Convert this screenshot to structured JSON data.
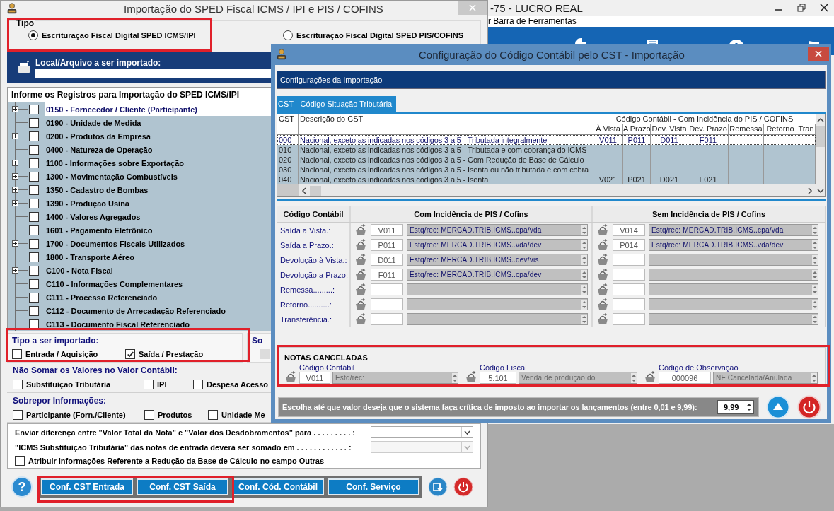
{
  "background_window": {
    "title": "-75 - LUCRO REAL",
    "menu_text": "r Barra de Ferramentas"
  },
  "import_window": {
    "title": "Importação do SPED Fiscal ICMS / IPI e PIS / COFINS",
    "tipo": {
      "label": "Tipo",
      "options": [
        {
          "label": "Escrituração Fiscal Digital SPED ICMS/IPI",
          "selected": true
        },
        {
          "label": "Escrituração Fiscal Digital SPED PIS/COFINS",
          "selected": false
        }
      ]
    },
    "file": {
      "label": "Local/Arquivo a ser importado:"
    },
    "registros": {
      "title": "Informe os Registros para Importação do SPED ICMS/IPI",
      "items": [
        {
          "label": "0150 - Fornecedor / Cliente (Participante)",
          "expandable": true,
          "checked": false,
          "selected": true
        },
        {
          "label": "0190 - Unidade de Medida",
          "expandable": false,
          "checked": false,
          "selected": false
        },
        {
          "label": "0200 - Produtos da Empresa",
          "expandable": true,
          "checked": false,
          "selected": false
        },
        {
          "label": "0400 - Natureza de Operação",
          "expandable": false,
          "checked": false,
          "selected": false
        },
        {
          "label": "1100 - Informações sobre Exportação",
          "expandable": true,
          "checked": false,
          "selected": false
        },
        {
          "label": "1300 - Movimentação Combustíveis",
          "expandable": true,
          "checked": false,
          "selected": false
        },
        {
          "label": "1350 - Cadastro de Bombas",
          "expandable": true,
          "checked": false,
          "selected": false
        },
        {
          "label": "1390 - Produção Usina",
          "expandable": true,
          "checked": false,
          "selected": false
        },
        {
          "label": "1400 - Valores Agregados",
          "expandable": false,
          "checked": false,
          "selected": false
        },
        {
          "label": "1601 - Pagamento Eletrônico",
          "expandable": false,
          "checked": false,
          "selected": false
        },
        {
          "label": "1700 - Documentos Fiscais Utilizados",
          "expandable": true,
          "checked": false,
          "selected": false
        },
        {
          "label": "1800 - Transporte Aéreo",
          "expandable": false,
          "checked": false,
          "selected": false
        },
        {
          "label": "C100 - Nota Fiscal",
          "expandable": true,
          "checked": false,
          "selected": false
        },
        {
          "label": "C110 - Informações Complementares",
          "expandable": false,
          "checked": false,
          "selected": false
        },
        {
          "label": "C111 - Processo Referenciado",
          "expandable": false,
          "checked": false,
          "selected": false
        },
        {
          "label": "C112 - Documento de Arrecadação Referenciado",
          "expandable": false,
          "checked": false,
          "selected": false
        },
        {
          "label": "C113 - Documento Fiscal Referenciado",
          "expandable": false,
          "checked": false,
          "selected": false
        }
      ]
    },
    "tipo_importado": {
      "label": "Tipo a ser importado:",
      "options": [
        {
          "label": "Entrada / Aquisição",
          "checked": false
        },
        {
          "label": "Saída / Prestação",
          "checked": true
        }
      ]
    },
    "side_group_label": "So",
    "nao_somar": {
      "label": "Não Somar os Valores no Valor Contábil:",
      "options": [
        {
          "label": "Substituição Tributária",
          "checked": false
        },
        {
          "label": "IPI",
          "checked": false
        },
        {
          "label": "Despesa Acesso",
          "checked": false
        }
      ]
    },
    "sobrepor": {
      "label": "Sobrepor Informações:",
      "options": [
        {
          "label": "Participante (Forn./Cliente)",
          "checked": false
        },
        {
          "label": "Produtos",
          "checked": false
        },
        {
          "label": "Unidade Me",
          "checked": false
        }
      ]
    },
    "settings": [
      {
        "kind": "combo",
        "label": "Enviar diferença entre \"Valor Total da Nota\" e \"Valor dos Desdobramentos\" para . . . . . . . . . :",
        "disabled": false
      },
      {
        "kind": "combo",
        "label": "\"ICMS Substituição Tributária\" das notas de entrada deverá ser somado em  . . . . . . . . . . . . :",
        "disabled": true
      },
      {
        "kind": "checkbox",
        "label": "Atribuir Informações Referente a Redução da Base de Cálculo no campo Outras",
        "checked": false
      }
    ],
    "help_label": "?",
    "buttons": [
      "Conf. CST Entrada",
      "Conf. CST Saída",
      "Conf. Cód. Contábil",
      "Conf. Serviço"
    ]
  },
  "dialog": {
    "title": "Configuração do Código Contábil pelo CST - Importação",
    "header": "Configurações da Importação",
    "tabs": [
      {
        "label": "CST - Código Situação Tributária",
        "selected": true
      }
    ],
    "table": {
      "columns": [
        "CST",
        "Descrição do CST"
      ],
      "group_header": "Código Contábil - Com Incidência do PIS / COFINS",
      "sub_columns": [
        "À Vista",
        "A Prazo",
        "Dev. Vista",
        "Dev. Prazo",
        "Remessa",
        "Retorno",
        "Tran"
      ],
      "rows": [
        {
          "cst": "000",
          "description": "Nacional, exceto as indicadas nos códigos 3 a 5 - Tributada integralmente",
          "codes": [
            "V011",
            "P011",
            "D011",
            "F011"
          ],
          "selected": true
        },
        {
          "cst": "010",
          "description": "Nacional, exceto as indicadas nos códigos 3 a 5 - Tributada e com cobrança do ICMS",
          "selected": false
        },
        {
          "cst": "020",
          "description": "Nacional, exceto as indicadas nos códigos 3 a 5 - Com Redução de Base de Cálculo",
          "selected": false
        },
        {
          "cst": "030",
          "description": "Nacional, exceto as indicadas nos códigos 3 a 5 - Isenta ou não tributada e com cobra",
          "selected": false
        },
        {
          "cst": "040",
          "description": "Nacional, exceto as indicadas nos códigos 3 a 5 - Isenta",
          "codes": [
            "V021",
            "P021",
            "D021",
            "F021"
          ],
          "selected": false
        }
      ]
    },
    "form": {
      "headers": [
        "Código Contábil",
        "Com Incidência de PIS / Cofins",
        "Sem Incidência de PIS / Cofins"
      ],
      "rows": [
        {
          "label": "Saída a Vista.:",
          "com": {
            "code": "V011",
            "desc": "Estq/rec: MERCAD.TRIB.ICMS..cpa/vda"
          },
          "sem": {
            "code": "V014",
            "desc": "Estq/rec: MERCAD.TRIB.ICMS..cpa/vda"
          }
        },
        {
          "label": "Saída a Prazo.:",
          "com": {
            "code": "P011",
            "desc": "Estq/rec: MERCAD.TRIB.ICMS..vda/dev"
          },
          "sem": {
            "code": "P014",
            "desc": "Estq/rec: MERCAD.TRIB.ICMS..vda/dev"
          }
        },
        {
          "label": "Devolução à Vista.:",
          "com": {
            "code": "D011",
            "desc": "Estq/rec: MERCAD.TRIB.ICMS..dev/vis"
          }
        },
        {
          "label": "Devolução a Prazo:",
          "com": {
            "code": "F011",
            "desc": "Estq/rec: MERCAD.TRIB.ICMS..cpa/dev"
          }
        },
        {
          "label": "Remessa.........:"
        },
        {
          "label": "Retorno..........:"
        },
        {
          "label": "Transferência.:"
        }
      ]
    },
    "notas_canceladas": {
      "title": "NOTAS CANCELADAS",
      "fields": [
        {
          "label": "Código Contábil",
          "code": "V011",
          "desc": "Estq/rec:"
        },
        {
          "label": "Código Fiscal",
          "code": "5.101",
          "desc": "Venda de produção do"
        },
        {
          "label": "Código de Observação",
          "code": "000096",
          "desc": "NF Cancelada/Anulada"
        }
      ]
    },
    "critica": {
      "label": "Escolha até que valor deseja que o sistema faça crítica de imposto ao importar os lançamentos (entre 0,01 e 9,99):",
      "value": "9,99"
    }
  }
}
